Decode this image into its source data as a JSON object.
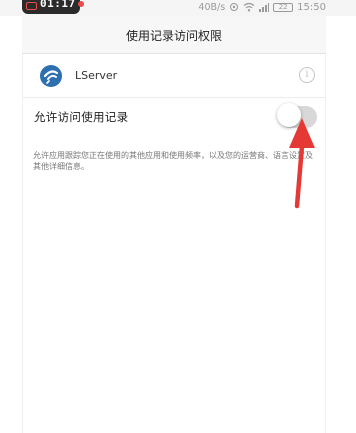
{
  "status_bar": {
    "record_time": "01:17",
    "net_speed": "40B/s",
    "battery_level": "22",
    "time": "15:50"
  },
  "header": {
    "title": "使用记录访问权限"
  },
  "app": {
    "name": "LServer",
    "info_glyph": "i"
  },
  "permission": {
    "toggle_label": "允许访问使用记录",
    "toggle_on": false,
    "description": "允许应用跟踪您正在使用的其他应用和使用频率，以及您的运营商、语言设置及其他详细信息。"
  },
  "colors": {
    "annotation_arrow": "#e53935",
    "app_icon": "#2e6fb0",
    "record_indicator": "#e94b4b"
  }
}
